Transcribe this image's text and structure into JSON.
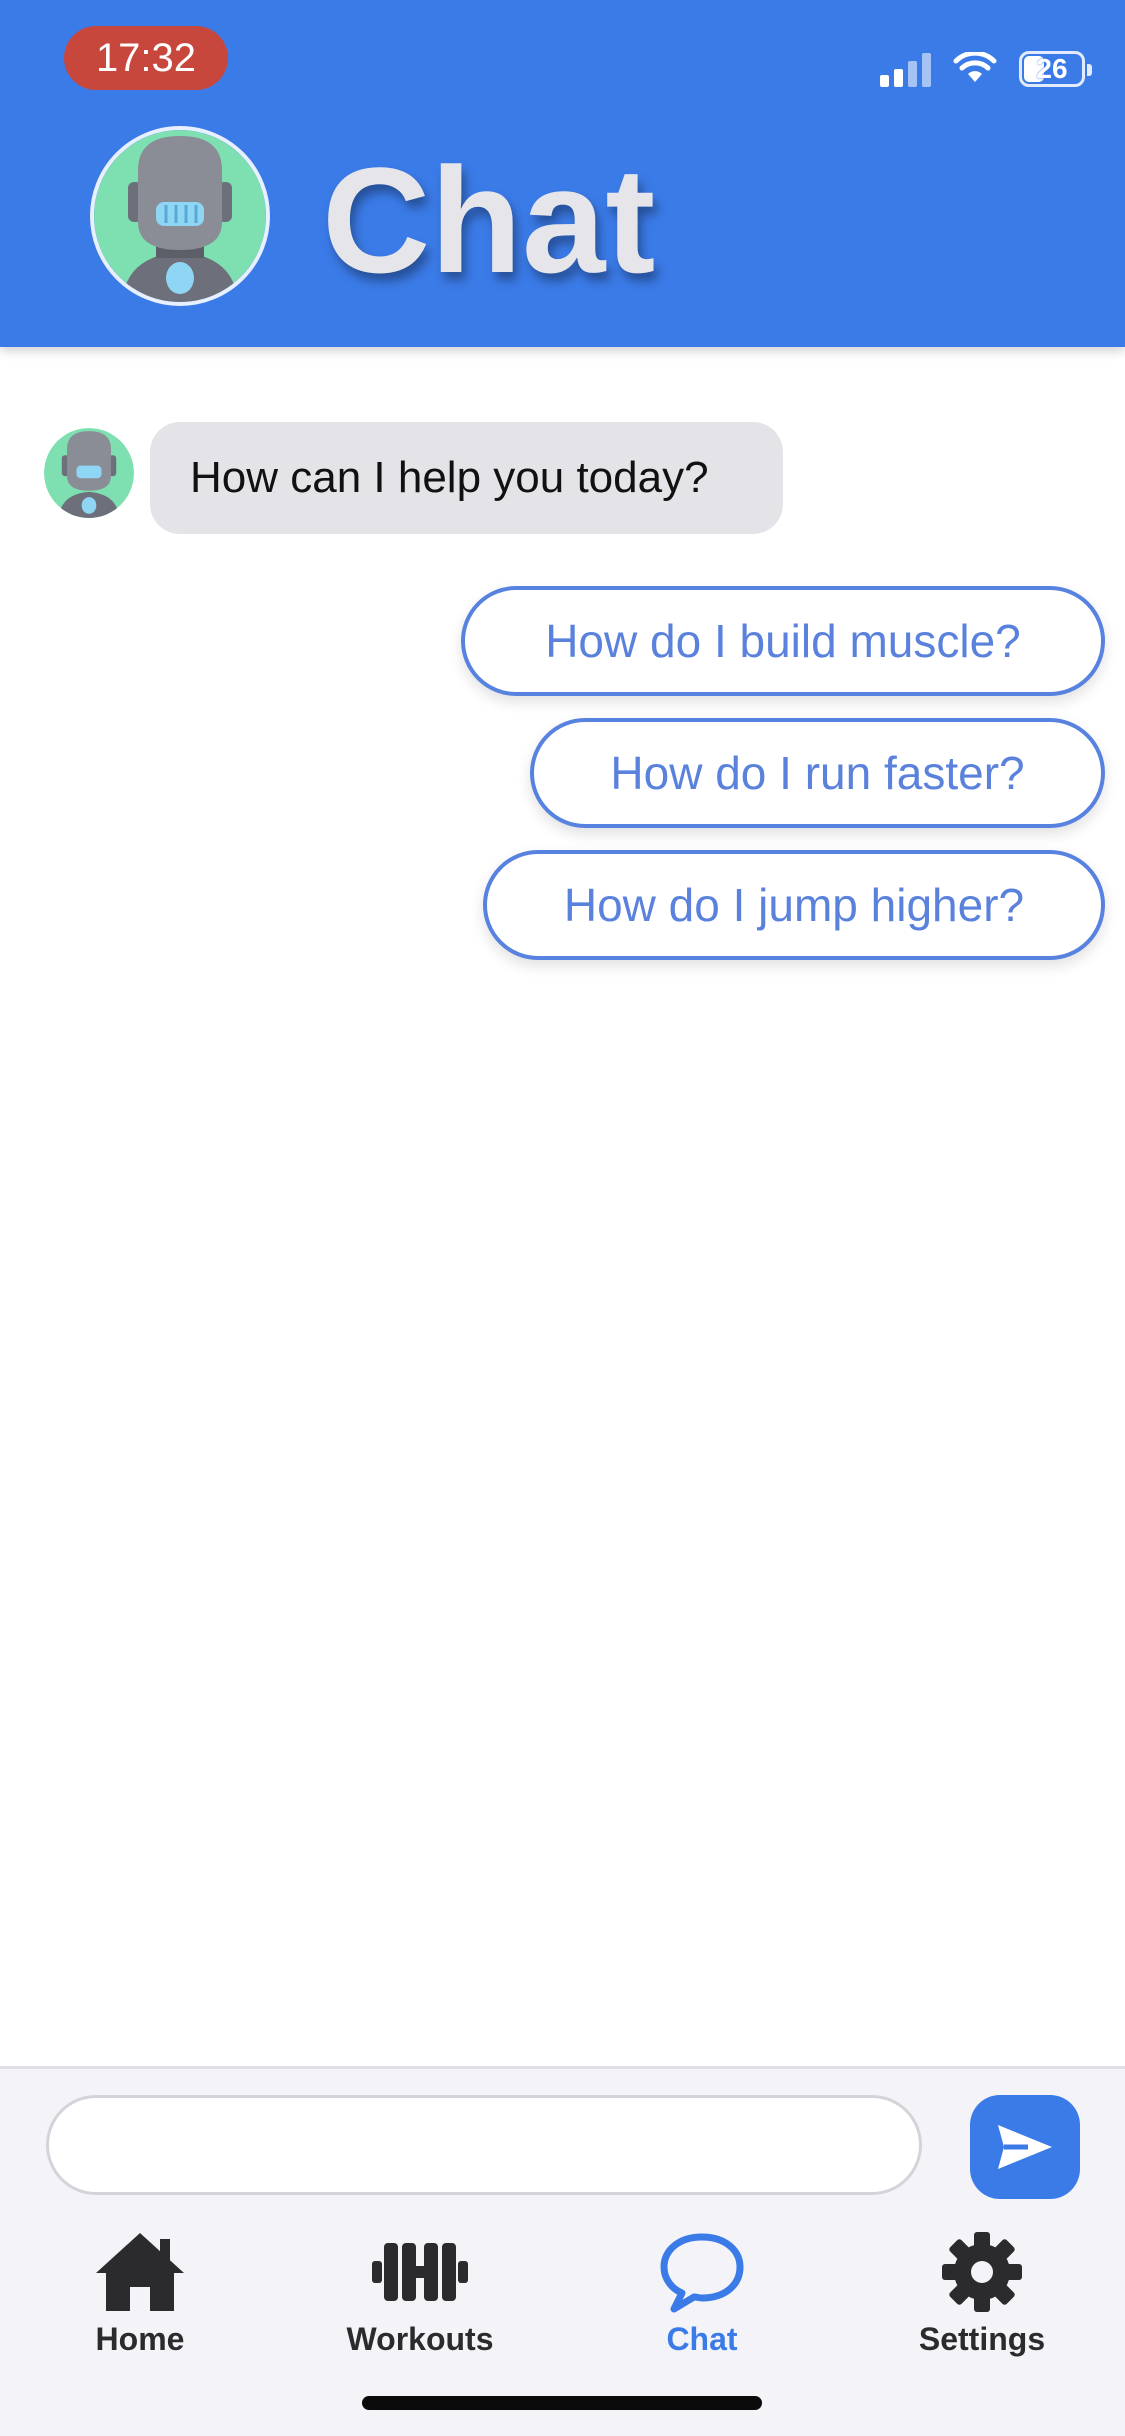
{
  "status_bar": {
    "time": "17:32",
    "battery": "26"
  },
  "header": {
    "title": "Chat",
    "avatar_icon": "robot-avatar-icon"
  },
  "chat": {
    "messages": [
      {
        "sender": "bot",
        "text": "How can I help you today?"
      }
    ],
    "suggestions": [
      "How do I build muscle?",
      "How do I run faster?",
      "How do I jump higher?"
    ]
  },
  "composer": {
    "input_value": "",
    "placeholder": "",
    "send_icon": "send-icon"
  },
  "tabbar": {
    "tabs": [
      {
        "label": "Home",
        "icon": "house-icon",
        "active": false
      },
      {
        "label": "Workouts",
        "icon": "dumbbell-icon",
        "active": false
      },
      {
        "label": "Chat",
        "icon": "speech-bubble-icon",
        "active": true
      },
      {
        "label": "Settings",
        "icon": "gear-icon",
        "active": false
      }
    ]
  },
  "colors": {
    "primary": "#3b7be8",
    "suggestion_border": "#5882e0",
    "bot_bubble": "#e4e4e8",
    "time_pill": "#c8473d",
    "avatar_bg": "#7ee0b0"
  }
}
